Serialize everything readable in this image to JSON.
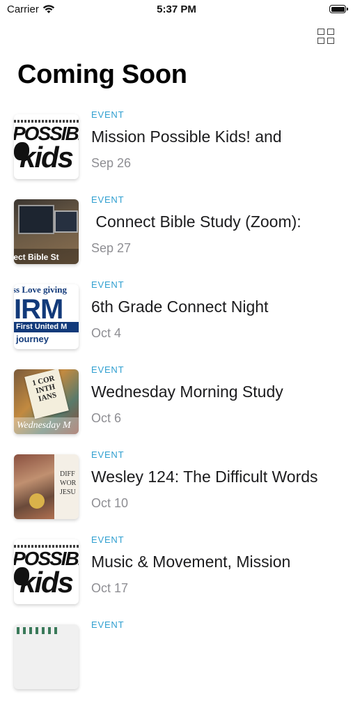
{
  "status_bar": {
    "carrier": "Carrier",
    "time": "5:37 PM"
  },
  "header": {
    "title": "Coming Soon"
  },
  "events": [
    {
      "type": "EVENT",
      "title": "Mission Possible Kids! and",
      "date": "Sep 26",
      "thumb_text": [
        "POSSIBL",
        "kids"
      ]
    },
    {
      "type": "EVENT",
      "title": " Connect Bible Study (Zoom):",
      "date": "Sep 27",
      "thumb_text": [
        "nect Bible St"
      ]
    },
    {
      "type": "EVENT",
      "title": "6th Grade Connect Night",
      "date": "Oct 4",
      "thumb_text": [
        "ss Love giving",
        "IRM",
        "First United M",
        "journey"
      ]
    },
    {
      "type": "EVENT",
      "title": "Wednesday Morning Study",
      "date": "Oct 6",
      "thumb_text": [
        "1 COR INTH IANS",
        "Wednesday M"
      ]
    },
    {
      "type": "EVENT",
      "title": "Wesley 124: The Difficult Words",
      "date": "Oct 10",
      "thumb_text": [
        "DIFF WOR JESU"
      ]
    },
    {
      "type": "EVENT",
      "title": "Music & Movement, Mission",
      "date": "Oct 17",
      "thumb_text": [
        "POSSIBL",
        "kids"
      ]
    },
    {
      "type": "EVENT",
      "title": "",
      "date": "",
      "thumb_text": []
    }
  ]
}
